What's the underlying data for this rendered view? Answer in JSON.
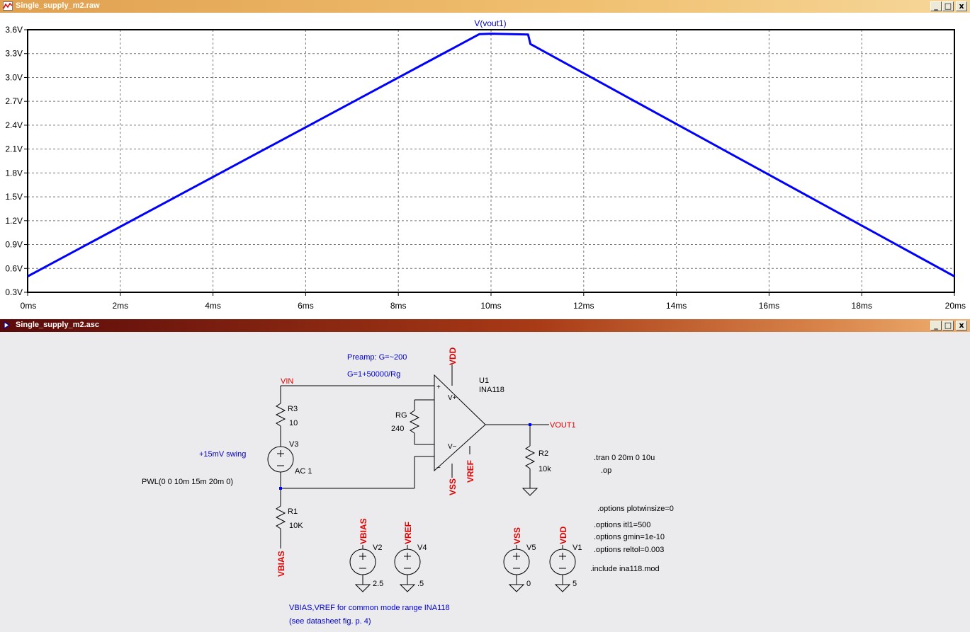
{
  "plot_window": {
    "title": "Single_supply_m2.raw"
  },
  "schematic_window": {
    "title": "Single_supply_m2.asc"
  },
  "window_controls": {
    "minimize": "_",
    "restore": "□",
    "close": "x"
  },
  "chart_data": {
    "type": "line",
    "title": "V(vout1)",
    "xlabel": "",
    "ylabel": "",
    "x_ticks": [
      "0ms",
      "2ms",
      "4ms",
      "6ms",
      "8ms",
      "10ms",
      "12ms",
      "14ms",
      "16ms",
      "18ms",
      "20ms"
    ],
    "y_ticks": [
      "0.3V",
      "0.6V",
      "0.9V",
      "1.2V",
      "1.5V",
      "1.8V",
      "2.1V",
      "2.4V",
      "2.7V",
      "3.0V",
      "3.3V",
      "3.6V"
    ],
    "xlim": [
      0,
      20
    ],
    "ylim": [
      0.3,
      3.6
    ],
    "grid": true,
    "series": [
      {
        "name": "V(vout1)",
        "color": "#0000ff",
        "x": [
          0,
          9.75,
          10.0,
          10.8,
          10.85,
          20
        ],
        "y": [
          0.5,
          3.545,
          3.55,
          3.54,
          3.42,
          0.5
        ]
      }
    ]
  },
  "schematic": {
    "comment_preamp": "Preamp: G=~200",
    "comment_gain": "G=1+50000/Rg",
    "net_vin": "VIN",
    "net_vdd": "VDD",
    "net_vss": "VSS",
    "net_vref": "VREF",
    "net_vbias": "VBIAS",
    "net_vout1": "VOUT1",
    "u1_name": "U1",
    "u1_value": "INA118",
    "pin_plus": "+",
    "pin_minus": "−",
    "pin_vplus": "V+",
    "pin_vminus": "V−",
    "rg_name": "RG",
    "rg_value": "240",
    "r3_name": "R3",
    "r3_value": "10",
    "r1_name": "R1",
    "r1_value": "10K",
    "r2_name": "R2",
    "r2_value": "10k",
    "v3_name": "V3",
    "v3_value": "AC 1",
    "swing_note": "+15mV swing",
    "pwl": "PWL(0 0 10m 15m 20m 0)",
    "v2_name": "V2",
    "v2_value": "2.5",
    "v4_name": "V4",
    "v4_value": ".5",
    "v5_name": "V5",
    "v5_value": "0",
    "v1_name": "V1",
    "v1_value": "5",
    "tran": ".tran 0 20m 0 10u",
    "op": ".op",
    "plotwinsize": ".options plotwinsize=0",
    "itl1": ".options itl1=500",
    "gmin": ".options gmin=1e-10",
    "reltol": ".options reltol=0.003",
    "include": ".include ina118.mod",
    "note1": "VBIAS,VREF for common mode range INA118",
    "note2": "(see datasheet fig. p. 4)"
  }
}
